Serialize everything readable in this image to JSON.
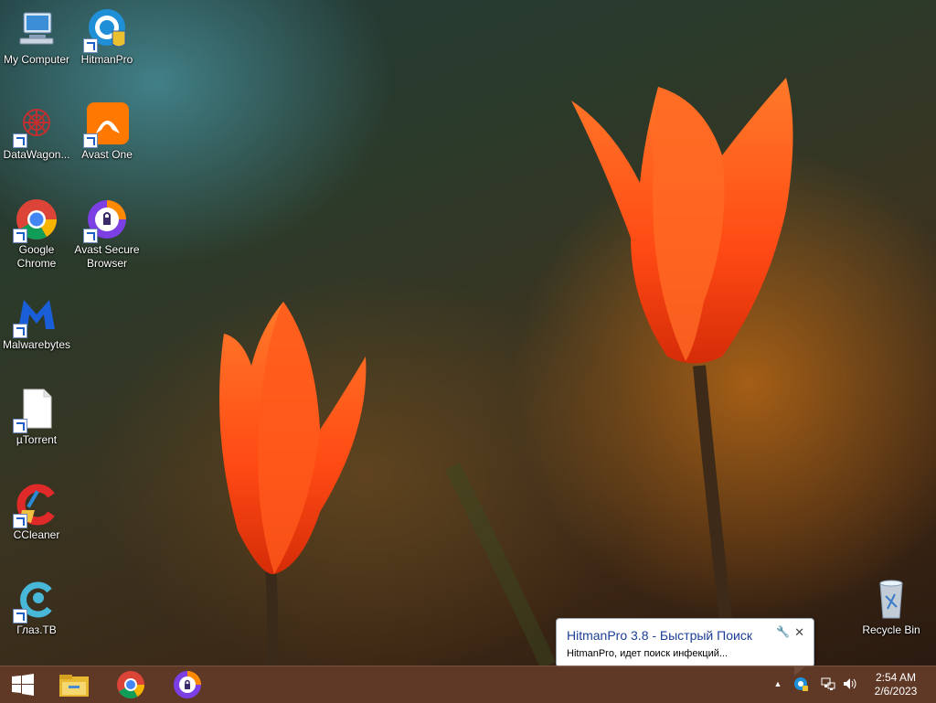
{
  "desktop": {
    "icons": [
      {
        "label": "My Computer",
        "icon": "computer-icon"
      },
      {
        "label": "HitmanPro",
        "icon": "hitmanpro-icon"
      },
      {
        "label": "DataWagon...",
        "icon": "datawagon-icon"
      },
      {
        "label": "Avast One",
        "icon": "avast-one-icon"
      },
      {
        "label": "Google Chrome",
        "icon": "chrome-icon"
      },
      {
        "label": "Avast Secure Browser",
        "icon": "avast-secure-browser-icon"
      },
      {
        "label": "Malwarebytes",
        "icon": "malwarebytes-icon"
      },
      {
        "label": "µTorrent",
        "icon": "file-icon"
      },
      {
        "label": "CCleaner",
        "icon": "ccleaner-icon"
      },
      {
        "label": "Глаз.ТВ",
        "icon": "glaz-tv-icon"
      },
      {
        "label": "Recycle Bin",
        "icon": "recycle-bin-icon"
      }
    ]
  },
  "notification": {
    "title": "HitmanPro 3.8 - Быстрый Поиск",
    "text": "HitmanPro, идет поиск инфекций...",
    "close": "✕",
    "options": "🔧"
  },
  "taskbar": {
    "start_icon": "windows-logo-icon",
    "pinned": [
      "file-explorer-icon",
      "chrome-icon",
      "avast-secure-browser-icon"
    ],
    "tray": {
      "overflow": "▲",
      "time": "2:54 AM",
      "date": "2/6/2023"
    }
  },
  "colors": {
    "taskbar": "#64392a",
    "balloon_title": "#1c3f94"
  }
}
